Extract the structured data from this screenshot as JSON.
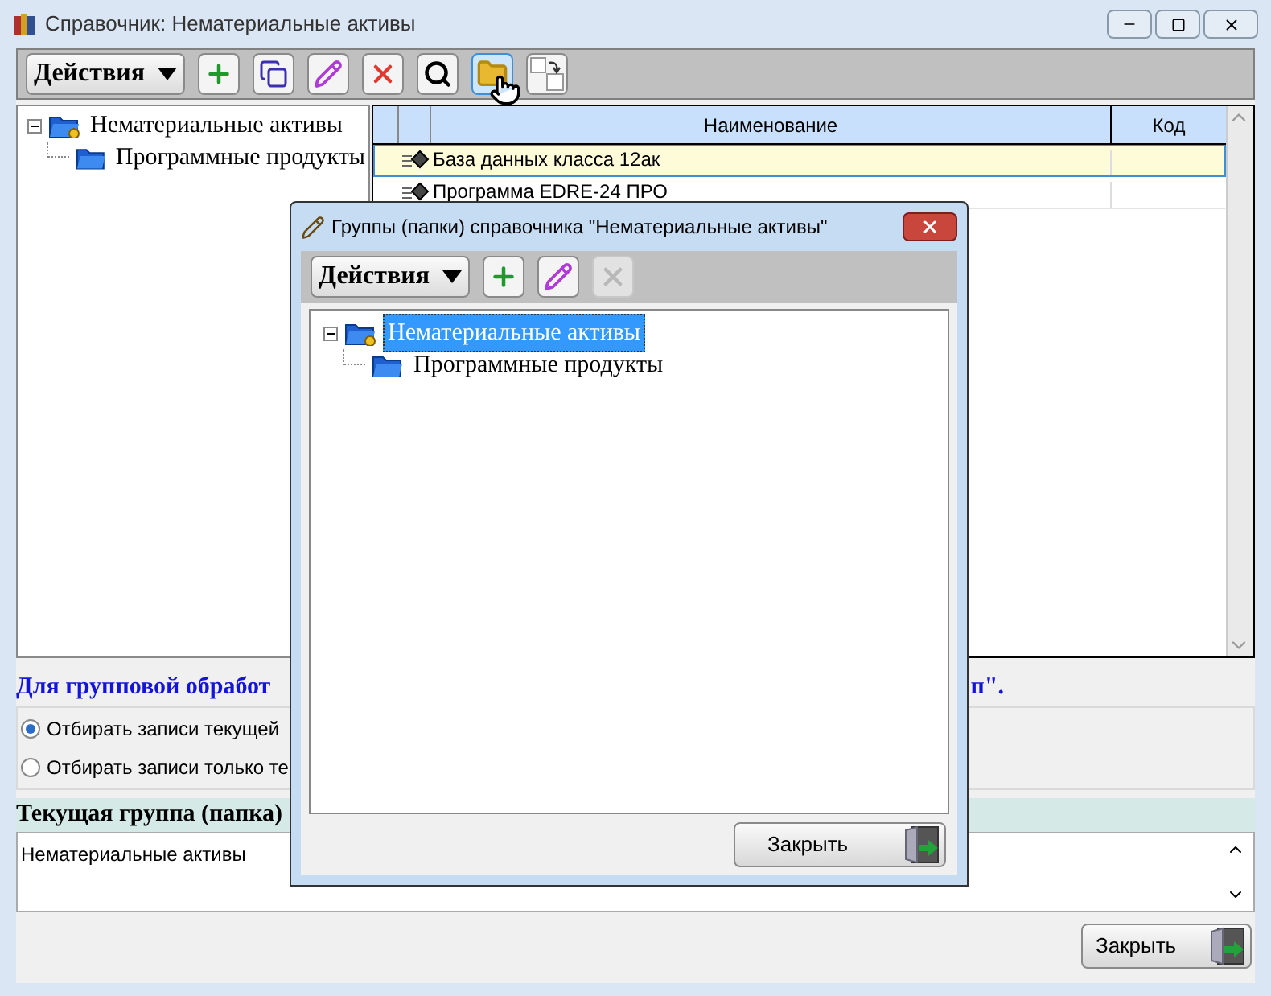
{
  "window": {
    "title": "Справочник: Нематериальные активы"
  },
  "toolbar": {
    "actions_label": "Действия",
    "buttons": [
      {
        "kind": "add",
        "selected": false
      },
      {
        "kind": "copy",
        "selected": false
      },
      {
        "kind": "edit",
        "selected": false
      },
      {
        "kind": "delete",
        "selected": false
      },
      {
        "kind": "search",
        "selected": false
      },
      {
        "kind": "groups",
        "selected": true
      },
      {
        "kind": "rename",
        "selected": false
      }
    ]
  },
  "tree": [
    {
      "label": "Нематериальные активы",
      "expanded": true,
      "children": [
        {
          "label": "Программные продукты"
        }
      ]
    }
  ],
  "grid": {
    "columns": [
      "Наименование",
      "Код"
    ],
    "rows": [
      {
        "name": "База данных класса 12ак",
        "selected": true
      },
      {
        "name": "Программа EDRE-24 ПРО",
        "selected": false
      }
    ]
  },
  "hint": {
    "left": "Для групповой обработ",
    "right": "п\"."
  },
  "filter_options": [
    {
      "label": "Отбирать записи текущей",
      "selected": true
    },
    {
      "label": "Отбирать записи только те",
      "selected": false
    }
  ],
  "current_group": {
    "title": "Текущая группа (папка)",
    "value": "Нематериальные активы"
  },
  "close_button": "Закрыть",
  "dialog": {
    "title": "Группы (папки) справочника \"Нематериальные активы\"",
    "actions_label": "Действия",
    "buttons": [
      {
        "kind": "add",
        "disabled": false
      },
      {
        "kind": "edit",
        "disabled": false
      },
      {
        "kind": "delete",
        "disabled": true
      }
    ],
    "tree": [
      {
        "label": "Нематериальные активы",
        "selected": true,
        "expanded": true,
        "children": [
          {
            "label": "Программные продукты",
            "selected": false
          }
        ]
      }
    ],
    "close_button": "Закрыть"
  }
}
